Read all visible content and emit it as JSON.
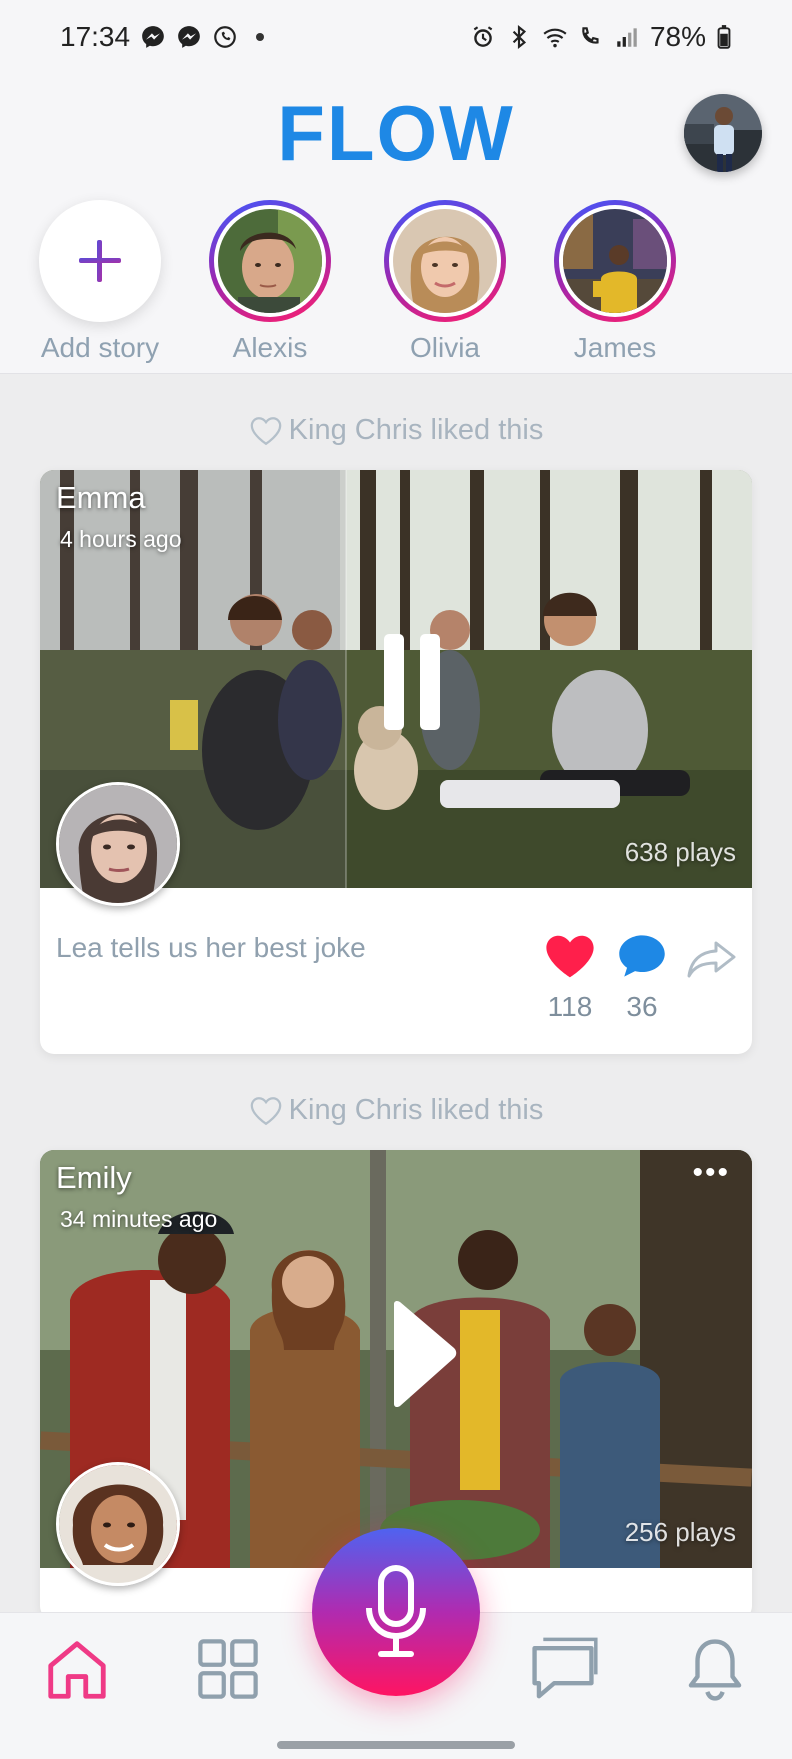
{
  "status_bar": {
    "time": "17:34",
    "battery": "78%",
    "left_icons": [
      "messenger-icon",
      "messenger-icon",
      "whatsapp-icon"
    ],
    "right_icons": [
      "alarm-icon",
      "bluetooth-icon",
      "wifi-icon",
      "wifi-call-icon",
      "signal-icon",
      "battery-icon"
    ]
  },
  "header": {
    "logo": "FLOW"
  },
  "stories": {
    "add_label": "Add story",
    "items": [
      {
        "name": "Alexis"
      },
      {
        "name": "Olivia"
      },
      {
        "name": "James"
      }
    ]
  },
  "colors": {
    "brand_blue": "#1e88e5",
    "like_red": "#ff1f4b",
    "comment_blue": "#1e88e5",
    "muted_text": "#90a0ae"
  },
  "feed": {
    "posts": [
      {
        "liked_by": "King Chris liked this",
        "author": "Emma",
        "time": "4 hours ago",
        "plays": "638 plays",
        "title": "Lea tells us her best joke",
        "likes": "118",
        "comments": "36",
        "state": "playing"
      },
      {
        "liked_by": "King Chris liked this",
        "author": "Emily",
        "time": "34 minutes ago",
        "plays": "256 plays",
        "state": "paused"
      }
    ]
  },
  "bottom_nav": {
    "items": [
      "home-icon",
      "grid-icon",
      "microphone-icon",
      "chat-icon",
      "bell-icon"
    ],
    "active": "home-icon"
  }
}
